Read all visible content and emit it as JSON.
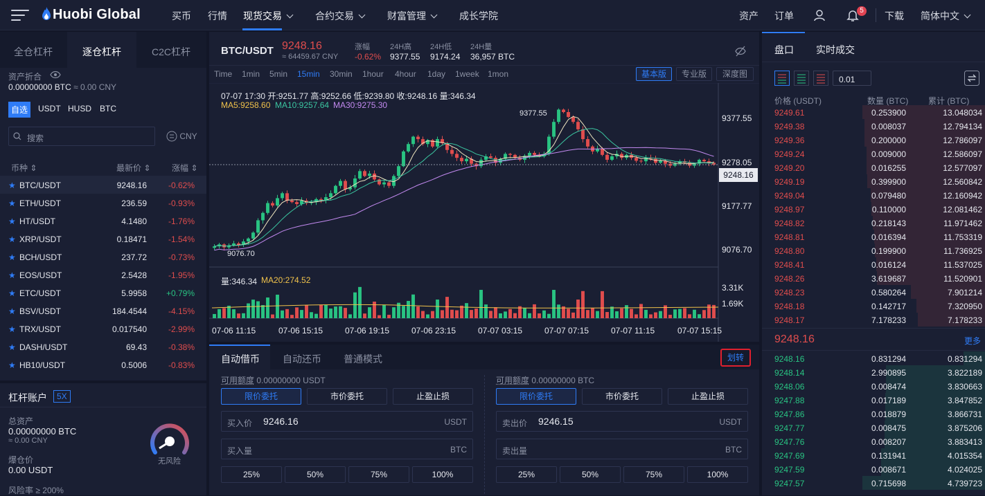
{
  "nav": {
    "logo": "Huobi Global",
    "items": [
      "买币",
      "行情",
      "现货交易",
      "合约交易",
      "财富管理",
      "成长学院"
    ],
    "right": [
      "资产",
      "订单",
      "下载",
      "简体中文"
    ],
    "badge": "5"
  },
  "left": {
    "tabs": [
      "全仓杠杆",
      "逐仓杠杆",
      "C2C杠杆"
    ],
    "asset_label": "资产折合",
    "asset_value": "0.00000000 BTC",
    "asset_cny": "≈ 0.00 CNY",
    "pair_tabs": [
      "自选",
      "USDT",
      "HUSD",
      "BTC"
    ],
    "search_placeholder": "搜索",
    "cny": "CNY",
    "cols": [
      "币种",
      "最新价",
      "涨幅"
    ],
    "pairs": [
      {
        "name": "BTC/USDT",
        "price": "9248.16",
        "chg": "-0.62%",
        "up": false
      },
      {
        "name": "ETH/USDT",
        "price": "236.59",
        "chg": "-0.93%",
        "up": false
      },
      {
        "name": "HT/USDT",
        "price": "4.1480",
        "chg": "-1.76%",
        "up": false
      },
      {
        "name": "XRP/USDT",
        "price": "0.18471",
        "chg": "-1.54%",
        "up": false
      },
      {
        "name": "BCH/USDT",
        "price": "237.72",
        "chg": "-0.73%",
        "up": false
      },
      {
        "name": "EOS/USDT",
        "price": "2.5428",
        "chg": "-1.95%",
        "up": false
      },
      {
        "name": "ETC/USDT",
        "price": "5.9958",
        "chg": "+0.79%",
        "up": true
      },
      {
        "name": "BSV/USDT",
        "price": "184.4544",
        "chg": "-4.15%",
        "up": false
      },
      {
        "name": "TRX/USDT",
        "price": "0.017540",
        "chg": "-2.99%",
        "up": false
      },
      {
        "name": "DASH/USDT",
        "price": "69.43",
        "chg": "-0.38%",
        "up": false
      },
      {
        "name": "HB10/USDT",
        "price": "0.5006",
        "chg": "-0.83%",
        "up": false
      }
    ]
  },
  "margin": {
    "title": "杠杆账户",
    "lev": "5X",
    "total_label": "总资产",
    "total": "0.00000000 BTC",
    "total_cny": "≈ 0.00 CNY",
    "liq_label": "爆仓价",
    "liq": "0.00 USDT",
    "risk_label": "风险率",
    "risk": "≥ 200%",
    "gauge_label": "无风险"
  },
  "ticker": {
    "pair": "BTC/USDT",
    "price": "9248.16",
    "cny": "≈ 64459.67 CNY",
    "chg_label": "涨幅",
    "chg": "-0.62%",
    "high_label": "24H高",
    "high": "9377.55",
    "low_label": "24H低",
    "low": "9174.24",
    "vol_label": "24H量",
    "vol": "36,957 BTC"
  },
  "chart": {
    "intervals": [
      "Time",
      "1min",
      "5min",
      "15min",
      "30min",
      "1hour",
      "4hour",
      "1day",
      "1week",
      "1mon"
    ],
    "active_interval": "15min",
    "views": [
      "基本版",
      "专业版",
      "深度图"
    ],
    "info": "07-07 17:30  开:9251.77 高:9252.66 低:9239.80 收:9248.16 量:346.34",
    "ma5": "MA5:9258.60",
    "ma10": "MA10:9257.64",
    "ma30": "MA30:9275.30",
    "y_ticks": [
      "9377.55",
      "9278.05",
      "9177.77",
      "9076.70"
    ],
    "cur": "9248.16",
    "hi_mark": "9377.55",
    "lo_mark": "9076.70",
    "vol_info": "量:346.34",
    "ma20": "MA20:274.52",
    "vol_ticks": [
      "3.31K",
      "1.69K"
    ],
    "x_ticks": [
      "07-06 11:15",
      "07-06 15:15",
      "07-06 19:15",
      "07-06 23:15",
      "07-07 03:15",
      "07-07 07:15",
      "07-07 11:15",
      "07-07 15:15"
    ]
  },
  "chart_data": {
    "type": "candlestick",
    "ylim": [
      9040,
      9400
    ],
    "closes": [
      9082,
      9086,
      9080,
      9084,
      9088,
      9085,
      9092,
      9098,
      9110,
      9135,
      9150,
      9170,
      9165,
      9180,
      9190,
      9175,
      9172,
      9168,
      9175,
      9170,
      9172,
      9178,
      9176,
      9182,
      9190,
      9205,
      9215,
      9198,
      9202,
      9220,
      9235,
      9225,
      9230,
      9218,
      9208,
      9212,
      9205,
      9225,
      9245,
      9275,
      9290,
      9305,
      9300,
      9290,
      9298,
      9285,
      9300,
      9292,
      9278,
      9270,
      9262,
      9255,
      9260,
      9250,
      9245,
      9258,
      9265,
      9262,
      9252,
      9260,
      9270,
      9268,
      9262,
      9258,
      9266,
      9272,
      9268,
      9265,
      9270,
      9305,
      9335,
      9360,
      9355,
      9345,
      9335,
      9320,
      9300,
      9285,
      9275,
      9280,
      9268,
      9258,
      9265,
      9270,
      9262,
      9268,
      9262,
      9256,
      9255,
      9262,
      9260,
      9252,
      9256,
      9250,
      9246,
      9250,
      9255,
      9252,
      9246,
      9250,
      9258,
      9255,
      9252,
      9248
    ],
    "volume_peaks": "variable"
  },
  "trade": {
    "tabs": [
      "自动借币",
      "自动还币",
      "普通模式"
    ],
    "transfer": "划转",
    "buy": {
      "avail_label": "可用额度",
      "avail": "0.00000000 USDT",
      "types": [
        "限价委托",
        "市价委托",
        "止盈止损"
      ],
      "price_label": "买入价",
      "price": "9246.16",
      "price_unit": "USDT",
      "amt_label": "买入量",
      "amt_unit": "BTC",
      "pcts": [
        "25%",
        "50%",
        "75%",
        "100%"
      ]
    },
    "sell": {
      "avail_label": "可用额度",
      "avail": "0.00000000 BTC",
      "types": [
        "限价委托",
        "市价委托",
        "止盈止损"
      ],
      "price_label": "卖出价",
      "price": "9246.15",
      "price_unit": "USDT",
      "amt_label": "卖出量",
      "amt_unit": "BTC",
      "pcts": [
        "25%",
        "50%",
        "75%",
        "100%"
      ]
    }
  },
  "book": {
    "tabs": [
      "盘口",
      "实时成交"
    ],
    "precision": "0.01",
    "cols": [
      "价格 (USDT)",
      "数量 (BTC)",
      "累计 (BTC)"
    ],
    "more": "更多",
    "last": "9248.16",
    "asks": [
      [
        "9249.61",
        "0.253900",
        "13.048034"
      ],
      [
        "9249.38",
        "0.008037",
        "12.794134"
      ],
      [
        "9249.36",
        "0.200000",
        "12.786097"
      ],
      [
        "9249.24",
        "0.009000",
        "12.586097"
      ],
      [
        "9249.20",
        "0.016255",
        "12.577097"
      ],
      [
        "9249.19",
        "0.399900",
        "12.560842"
      ],
      [
        "9249.04",
        "0.079480",
        "12.160942"
      ],
      [
        "9248.97",
        "0.110000",
        "12.081462"
      ],
      [
        "9248.82",
        "0.218143",
        "11.971462"
      ],
      [
        "9248.81",
        "0.016394",
        "11.753319"
      ],
      [
        "9248.80",
        "0.199900",
        "11.736925"
      ],
      [
        "9248.41",
        "0.016124",
        "11.537025"
      ],
      [
        "9248.26",
        "3.619687",
        "11.520901"
      ],
      [
        "9248.23",
        "0.580264",
        "7.901214"
      ],
      [
        "9248.18",
        "0.142717",
        "7.320950"
      ],
      [
        "9248.17",
        "7.178233",
        "7.178233"
      ]
    ],
    "bids": [
      [
        "9248.16",
        "0.831294",
        "0.831294"
      ],
      [
        "9248.14",
        "2.990895",
        "3.822189"
      ],
      [
        "9248.06",
        "0.008474",
        "3.830663"
      ],
      [
        "9247.88",
        "0.017189",
        "3.847852"
      ],
      [
        "9247.86",
        "0.018879",
        "3.866731"
      ],
      [
        "9247.77",
        "0.008475",
        "3.875206"
      ],
      [
        "9247.76",
        "0.008207",
        "3.883413"
      ],
      [
        "9247.69",
        "0.131941",
        "4.015354"
      ],
      [
        "9247.59",
        "0.008671",
        "4.024025"
      ],
      [
        "9247.57",
        "0.715698",
        "4.739723"
      ]
    ]
  }
}
